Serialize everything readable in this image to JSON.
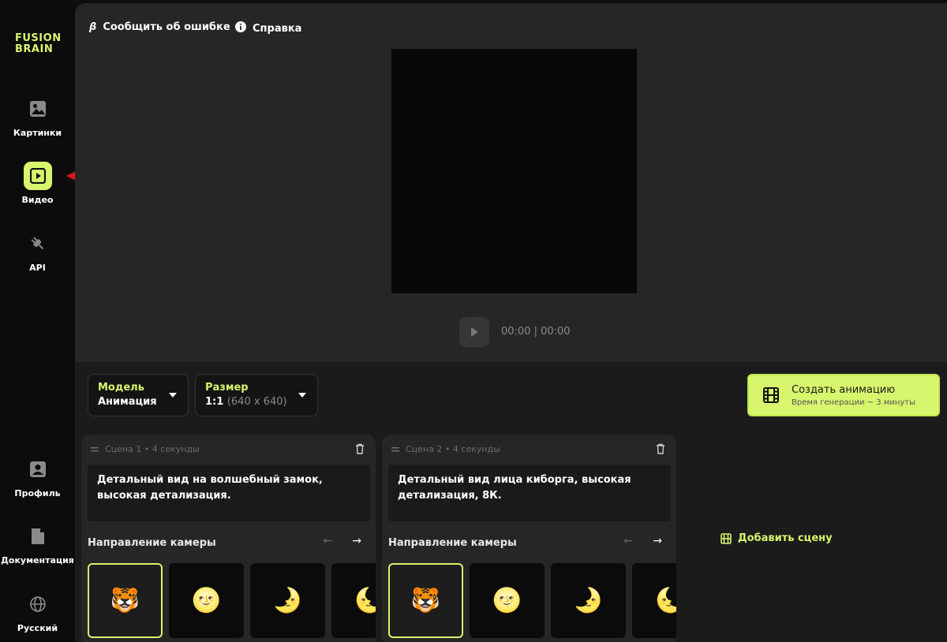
{
  "brand": {
    "line1": "FUSION",
    "line2": "BRAIN",
    "color": "#d7f56d"
  },
  "sidebar": {
    "items": [
      {
        "label": "Картинки",
        "icon": "image-icon"
      },
      {
        "label": "Видео",
        "icon": "play-icon",
        "active": true
      },
      {
        "label": "API",
        "icon": "plug-icon"
      }
    ],
    "bottom": [
      {
        "label": "Профиль",
        "icon": "profile-icon"
      },
      {
        "label": "Документация",
        "icon": "document-icon"
      },
      {
        "label": "Русский",
        "icon": "globe-icon"
      }
    ]
  },
  "header": {
    "bug_report": "Сообщить об ошибке",
    "bug_icon": "β",
    "help": "Справка"
  },
  "player": {
    "timecode": "00:00 | 00:00"
  },
  "settings": {
    "model": {
      "label": "Модель",
      "value": "Анимация"
    },
    "size": {
      "label": "Размер",
      "value": "1:1",
      "detail": "(640 x 640)"
    }
  },
  "create": {
    "label": "Создать анимацию",
    "sub": "Время генерации ~ 3 минуты"
  },
  "scenes": [
    {
      "title": "Сцена 1 • 4 секунды",
      "prompt": "Детальный вид на волшебный замок, высокая детализация.",
      "camera_title": "Направление камеры",
      "thumbs": [
        "🐯",
        "🌝",
        "🌛",
        "🌜"
      ]
    },
    {
      "title": "Сцена 2 • 4 секунды",
      "prompt": "Детальный вид лица киборга, высокая детализация, 8К.",
      "camera_title": "Направление камеры",
      "thumbs": [
        "🐯",
        "🌝",
        "🌛",
        "🌜"
      ]
    }
  ],
  "add_scene": "Добавить сцену",
  "nav_arrows": {
    "prev": "←",
    "next": "→"
  }
}
